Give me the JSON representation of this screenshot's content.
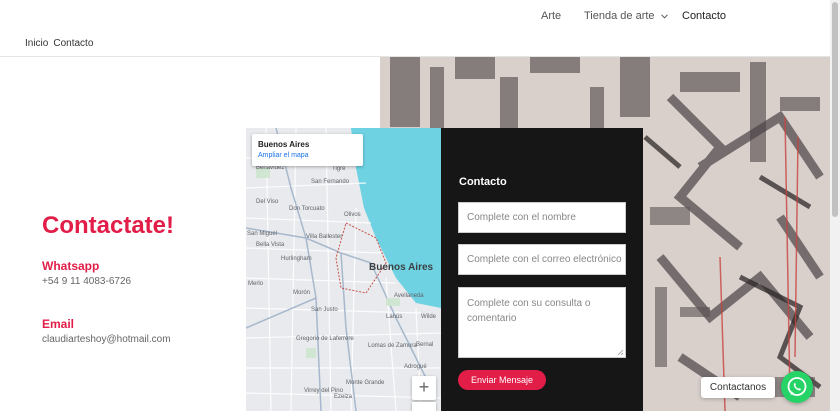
{
  "nav": {
    "items": [
      {
        "label": "Arte"
      },
      {
        "label": "Tienda de arte"
      },
      {
        "label": "Contacto"
      }
    ]
  },
  "breadcrumb": {
    "home": "Inicio",
    "current": "Contacto"
  },
  "contact_info": {
    "heading": "Contactate!",
    "whatsapp_label": "Whatsapp",
    "whatsapp_value": "+54 9 11 4083-6726",
    "email_label": "Email",
    "email_value": "claudiarteshoy@hotmail.com"
  },
  "map": {
    "place_title": "Buenos Aires",
    "enlarge_link": "Ampliar el mapa",
    "labels": {
      "benavidez": "Benavídez",
      "san_fernando": "San Fernando",
      "tigre": "Tigre",
      "bell_ville": "Bella Vista",
      "san_miguel": "San Miguel",
      "hurlingham": "Hurlingham",
      "villa_ballester": "Villa Ballester",
      "olivos": "Olivos",
      "don_torcuato": "Don Torcuato",
      "del_viso": "Del Viso",
      "buenos_aires": "Buenos Aires",
      "merlo": "Merlo",
      "moron": "Morón",
      "san_justo": "San Justo",
      "avellaneda": "Avellaneda",
      "lanus": "Lanús",
      "wilde": "Wilde",
      "gregorio": "Gregorio de Laferrere",
      "lomas": "Lomas de Zamora",
      "monte_grande": "Monte Grande",
      "ezeiza": "Ezeiza",
      "virrey": "Virrey del Pino",
      "bernal": "Bernal",
      "adrogue": "Adrogué"
    },
    "zoom_in": "+"
  },
  "form": {
    "title": "Contacto",
    "name_placeholder": "Complete con el nombre",
    "email_placeholder": "Complete con el correo electrónico",
    "message_placeholder": "Complete con su consulta o comentario",
    "submit_label": "Enviar Mensaje"
  },
  "floating": {
    "chat_label": "Contactanos"
  },
  "colors": {
    "accent": "#e11d48",
    "form_bg": "#161616",
    "whatsapp": "#25d366",
    "map_water": "#6fd2e3"
  }
}
